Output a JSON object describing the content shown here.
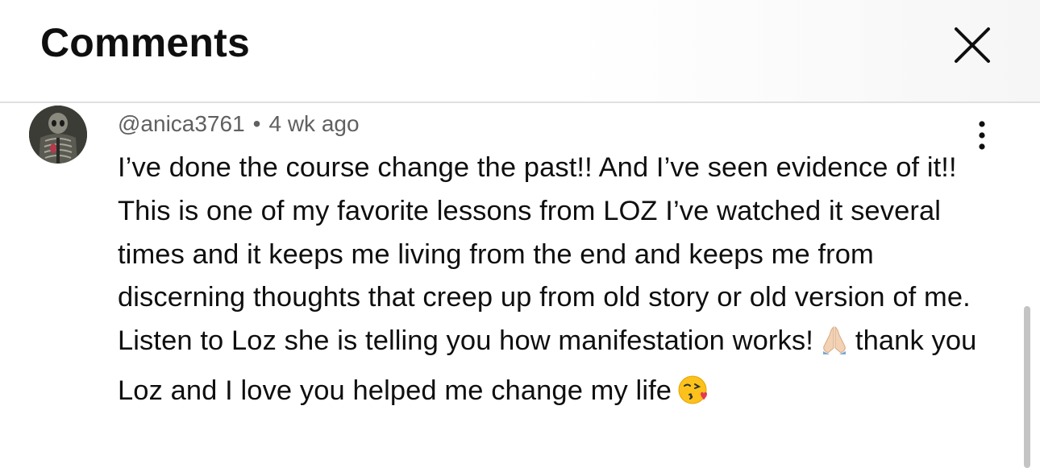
{
  "header": {
    "title": "Comments",
    "close_icon": "close-icon"
  },
  "comment": {
    "author": "@anica3761",
    "separator": "•",
    "timestamp": "4 wk ago",
    "text_part1": "I’ve done the course change the past!! And I’ve seen evidence of it!! This is one of my favorite lessons from LOZ I’ve watched it several times and it keeps me living from the end and keeps me from discerning thoughts that creep up from old story or old version of me. Listen to Loz she is telling you how manifestation works!",
    "emoji_1": "folded-hands-emoji",
    "text_part2": "thank you Loz and I love you helped me change my life",
    "emoji_2": "face-blowing-kiss-emoji",
    "more_icon": "more-vertical-icon"
  },
  "colors": {
    "text": "#0f0f0f",
    "meta": "#606060",
    "divider": "#e0e0e0",
    "scrollbar": "#c4c4c4"
  }
}
